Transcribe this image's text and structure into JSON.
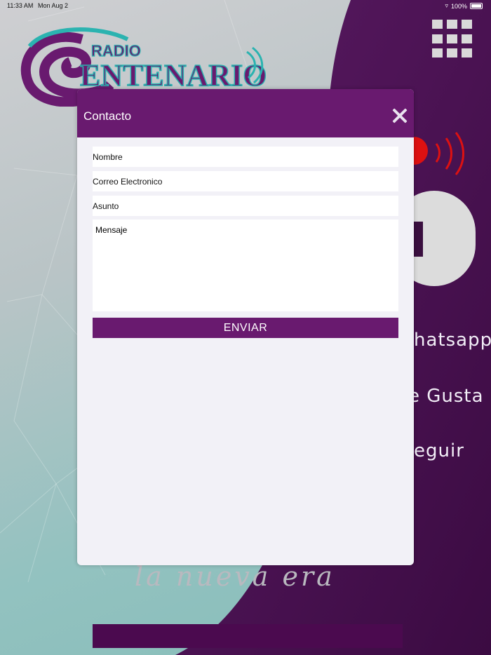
{
  "status_bar": {
    "time": "11:33 AM",
    "date": "Mon Aug 2",
    "battery": "100%"
  },
  "logo": {
    "top_word": "RADIO",
    "main_word": "ENTENARIO"
  },
  "background_links": {
    "whatsapp": "hatsapp",
    "like": "e Gusta",
    "follow": "eguir"
  },
  "slogan": "la nueva era",
  "modal": {
    "title": "Contacto",
    "fields": {
      "name": "Nombre",
      "email": "Correo Electronico",
      "subject": "Asunto",
      "message": "Mensaje"
    },
    "submit_label": "ENVIAR"
  },
  "colors": {
    "modal_header": "#691a6f",
    "button": "#691a6f",
    "modal_body": "#f2f1f7"
  },
  "icons": {
    "close": "close-icon",
    "menu": "grid-menu-icon",
    "speaker": "speaker-icon"
  }
}
